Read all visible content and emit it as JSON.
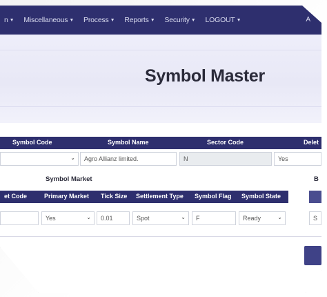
{
  "navbar": {
    "items": [
      {
        "label": "n"
      },
      {
        "label": "Miscellaneous"
      },
      {
        "label": "Process"
      },
      {
        "label": "Reports"
      },
      {
        "label": "Security"
      },
      {
        "label": "LOGOUT"
      }
    ],
    "end_text": "A"
  },
  "page": {
    "title": "Symbol Master"
  },
  "symbol_table": {
    "headers": {
      "symbol_code": "Symbol Code",
      "symbol_name": "Symbol Name",
      "sector_code": "Sector Code",
      "delete": "Delet"
    },
    "row": {
      "symbol_code": "",
      "symbol_name": "Agro Allianz limited.",
      "sector_code": "N",
      "delete": "Yes"
    }
  },
  "market_section": {
    "label": "Symbol Market",
    "right_label": "B",
    "headers": {
      "market_code": "et Code",
      "primary_market": "Primary Market",
      "tick_size": "Tick Size",
      "settlement_type": "Settlement Type",
      "symbol_flag": "Symbol Flag",
      "symbol_state": "Symbol State"
    },
    "row": {
      "market_code": "",
      "primary_market": "Yes",
      "tick_size": "0.01",
      "settlement_type": "Spot",
      "symbol_flag": "F",
      "symbol_state": "Ready",
      "right_value": "S"
    }
  }
}
